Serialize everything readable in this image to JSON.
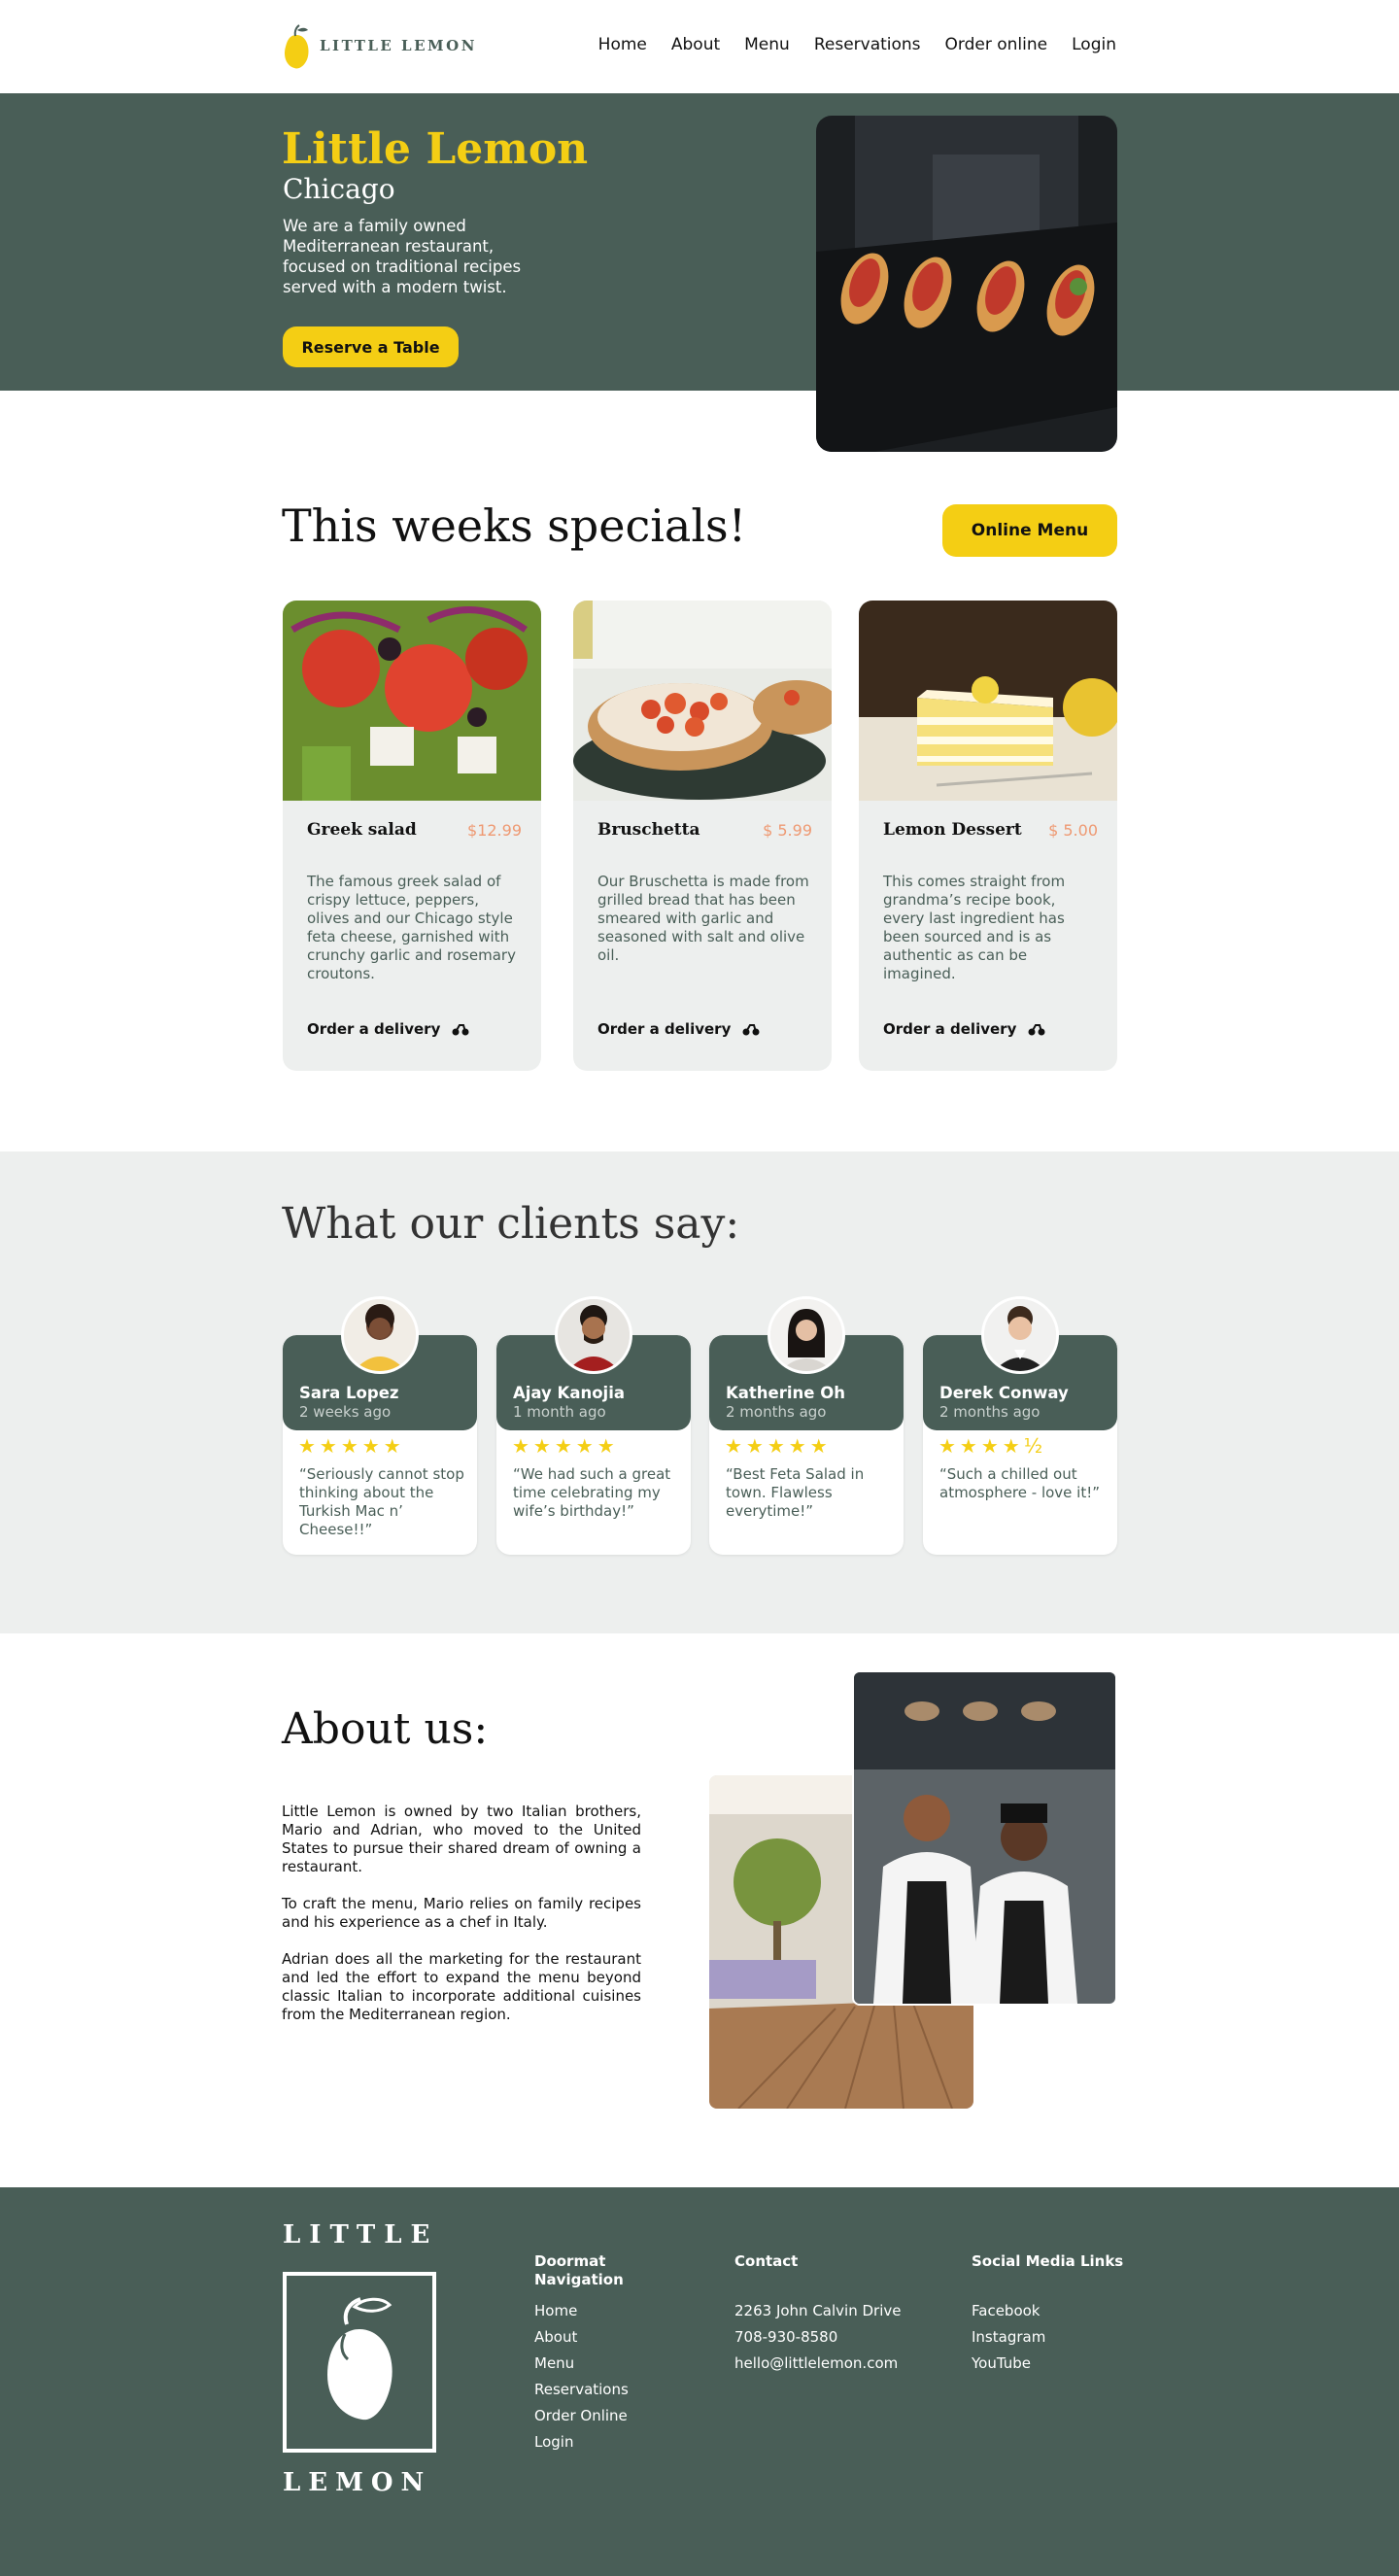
{
  "nav": {
    "brand": "LITTLE LEMON",
    "links": [
      "Home",
      "About",
      "Menu",
      "Reservations",
      "Order online",
      "Login"
    ]
  },
  "hero": {
    "title": "Little Lemon",
    "subtitle": "Chicago",
    "description": "We are a family owned Mediterranean restaurant, focused on traditional recipes served with a modern twist.",
    "cta": "Reserve a Table"
  },
  "specials": {
    "title": "This weeks specials!",
    "menu_button": "Online Menu",
    "items": [
      {
        "name": "Greek salad",
        "price": "$12.99",
        "description": "The famous greek salad of crispy lettuce, peppers, olives and our Chicago style feta cheese, garnished with crunchy garlic and rosemary croutons.",
        "order": "Order a delivery"
      },
      {
        "name": "Bruschetta",
        "price": "$ 5.99",
        "description": "Our Bruschetta is made from grilled bread that has been smeared with garlic and seasoned with salt and olive oil.",
        "order": "Order a delivery"
      },
      {
        "name": "Lemon Dessert",
        "price": "$ 5.00",
        "description": "This comes straight from grandma’s recipe book, every last ingredient has been sourced and is as authentic as can be imagined.",
        "order": "Order a delivery"
      }
    ]
  },
  "testimonials": {
    "title": "What our clients say:",
    "items": [
      {
        "name": "Sara Lopez",
        "time": "2 weeks ago",
        "stars": "★★★★★",
        "rating": 5,
        "quote": "“Seriously cannot stop thinking about the Turkish Mac n’ Cheese!!”"
      },
      {
        "name": "Ajay Kanojia",
        "time": "1 month ago",
        "stars": "★★★★★",
        "rating": 5,
        "quote": "“We had such a great time celebrating my wife’s birthday!”"
      },
      {
        "name": "Katherine Oh",
        "time": "2 months ago",
        "stars": "★★★★★",
        "rating": 5,
        "quote": "“Best Feta Salad in town. Flawless everytime!”"
      },
      {
        "name": "Derek Conway",
        "time": "2 months ago",
        "stars": "★★★★½",
        "rating": 4.5,
        "quote": "“Such a chilled out atmosphere - love it!”"
      }
    ]
  },
  "about": {
    "title": "About us:",
    "paragraphs": [
      "Little Lemon is owned by two Italian brothers, Mario and Adrian, who moved to the United States to pursue their shared dream of owning a restaurant.",
      "To craft the menu, Mario relies on family recipes and his experience as a chef in Italy.",
      "Adrian does all the marketing for the restaurant and led the effort to expand the menu beyond classic Italian to incorporate additional cuisines from the Mediterranean region."
    ]
  },
  "footer": {
    "logo_top": "LITTLE",
    "logo_bottom": "LEMON",
    "nav_title": "Doormat Navigation",
    "nav_links": [
      "Home",
      "About",
      "Menu",
      "Reservations",
      "Order Online",
      "Login"
    ],
    "contact_title": "Contact",
    "contact": [
      "2263 John Calvin Drive",
      "708-930-8580",
      "hello@littlelemon.com"
    ],
    "social_title": "Social Media Links",
    "social": [
      "Facebook",
      "Instagram",
      "YouTube"
    ]
  },
  "colors": {
    "primary_green": "#495e57",
    "primary_yellow": "#f4ce14",
    "accent_salmon": "#ee9972",
    "light_gray": "#edefee"
  }
}
